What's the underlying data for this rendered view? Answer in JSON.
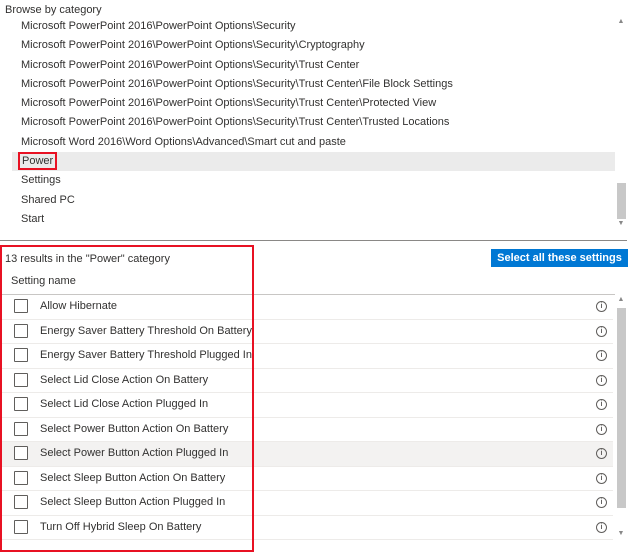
{
  "browse": {
    "heading": "Browse by category",
    "categories": [
      {
        "label": "Microsoft PowerPoint 2016\\PowerPoint Options\\Security"
      },
      {
        "label": "Microsoft PowerPoint 2016\\PowerPoint Options\\Security\\Cryptography"
      },
      {
        "label": "Microsoft PowerPoint 2016\\PowerPoint Options\\Security\\Trust Center"
      },
      {
        "label": "Microsoft PowerPoint 2016\\PowerPoint Options\\Security\\Trust Center\\File Block Settings"
      },
      {
        "label": "Microsoft PowerPoint 2016\\PowerPoint Options\\Security\\Trust Center\\Protected View"
      },
      {
        "label": "Microsoft PowerPoint 2016\\PowerPoint Options\\Security\\Trust Center\\Trusted Locations"
      },
      {
        "label": "Microsoft Word 2016\\Word Options\\Advanced\\Smart cut and paste"
      },
      {
        "label": "Power",
        "selected": true
      },
      {
        "label": "Settings"
      },
      {
        "label": "Shared PC"
      },
      {
        "label": "Start"
      }
    ]
  },
  "results": {
    "summary": "13 results in the \"Power\" category",
    "select_all_label": "Select all these settings",
    "column_header": "Setting name",
    "settings": [
      {
        "label": "Allow Hibernate"
      },
      {
        "label": "Energy Saver Battery Threshold On Battery"
      },
      {
        "label": "Energy Saver Battery Threshold Plugged In"
      },
      {
        "label": "Select Lid Close Action On Battery"
      },
      {
        "label": "Select Lid Close Action Plugged In"
      },
      {
        "label": "Select Power Button Action On Battery"
      },
      {
        "label": "Select Power Button Action Plugged In",
        "highlighted": true
      },
      {
        "label": "Select Sleep Button Action On Battery"
      },
      {
        "label": "Select Sleep Button Action Plugged In"
      },
      {
        "label": "Turn Off Hybrid Sleep On Battery"
      }
    ]
  },
  "icons": {
    "info": "info-icon",
    "checkbox": "checkbox-icon",
    "scroll_up": "chevron-up-icon",
    "scroll_down": "chevron-down-icon"
  },
  "colors": {
    "accent": "#0078d4",
    "annotation_red": "#e81123",
    "selected_row": "#ebebeb"
  }
}
